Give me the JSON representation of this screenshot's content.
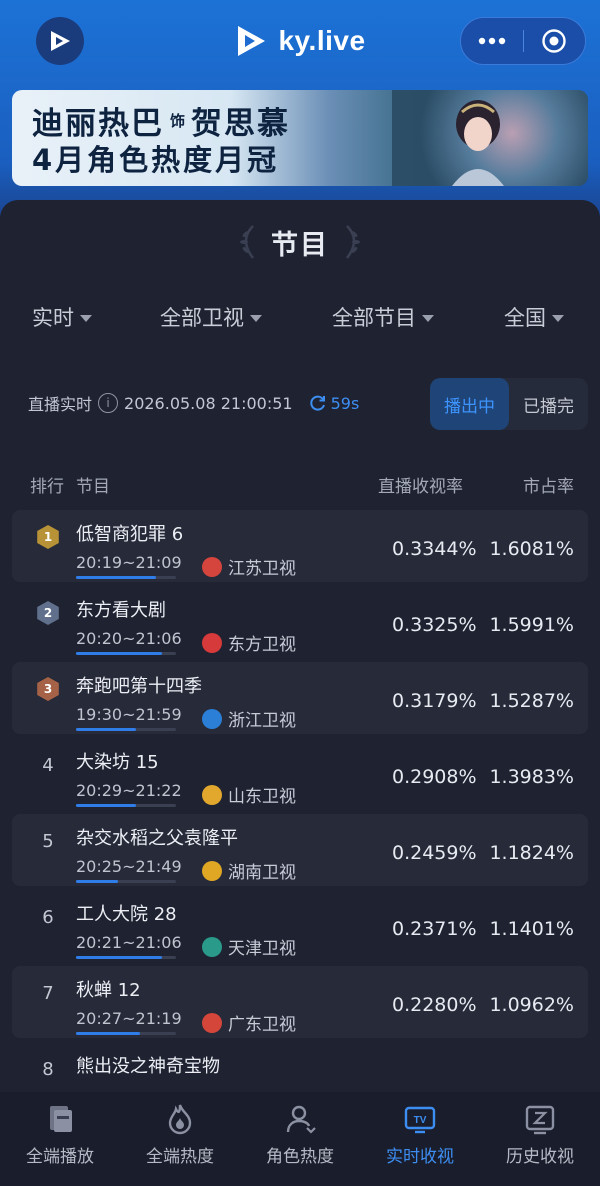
{
  "header": {
    "brand": "ky.live",
    "banner_line1_a": "迪丽热巴",
    "banner_line1_small": "饰",
    "banner_line1_b": "贺思慕",
    "banner_line2": "4月角色热度月冠"
  },
  "section": {
    "title": "节目"
  },
  "filters": [
    {
      "label": "实时"
    },
    {
      "label": "全部卫视"
    },
    {
      "label": "全部节目"
    },
    {
      "label": "全国"
    }
  ],
  "status": {
    "label": "直播实时",
    "datetime": "2026.05.08 21:00:51",
    "countdown": "59s"
  },
  "toggle": {
    "on_air": "播出中",
    "ended": "已播完"
  },
  "table": {
    "headers": {
      "rank": "排行",
      "program": "节目",
      "rating": "直播收视率",
      "share": "市占率"
    },
    "rows": [
      {
        "rank": "1",
        "name": "低智商犯罪 6",
        "time": "20:19~21:09",
        "channel": "江苏卫视",
        "rating": "0.3344%",
        "share": "1.6081%",
        "progress": 0.8,
        "medal": "#b79237",
        "logo": "#d5453d"
      },
      {
        "rank": "2",
        "name": "东方看大剧",
        "time": "20:20~21:06",
        "channel": "东方卫视",
        "rating": "0.3325%",
        "share": "1.5991%",
        "progress": 0.86,
        "medal": "#5f6f8c",
        "logo": "#d63a3a"
      },
      {
        "rank": "3",
        "name": "奔跑吧第十四季",
        "time": "19:30~21:59",
        "channel": "浙江卫视",
        "rating": "0.3179%",
        "share": "1.5287%",
        "progress": 0.6,
        "medal": "#a56246",
        "logo": "#2b7fd6"
      },
      {
        "rank": "4",
        "name": "大染坊 15",
        "time": "20:29~21:22",
        "channel": "山东卫视",
        "rating": "0.2908%",
        "share": "1.3983%",
        "progress": 0.6,
        "medal": "",
        "logo": "#e1a82d"
      },
      {
        "rank": "5",
        "name": "杂交水稻之父袁隆平",
        "time": "20:25~21:49",
        "channel": "湖南卫视",
        "rating": "0.2459%",
        "share": "1.1824%",
        "progress": 0.42,
        "medal": "",
        "logo": "#e0a725"
      },
      {
        "rank": "6",
        "name": "工人大院 28",
        "time": "20:21~21:06",
        "channel": "天津卫视",
        "rating": "0.2371%",
        "share": "1.1401%",
        "progress": 0.86,
        "medal": "",
        "logo": "#2a9a8a"
      },
      {
        "rank": "7",
        "name": "秋蝉 12",
        "time": "20:27~21:19",
        "channel": "广东卫视",
        "rating": "0.2280%",
        "share": "1.0962%",
        "progress": 0.64,
        "medal": "",
        "logo": "#d4463a"
      },
      {
        "rank": "8",
        "name": "熊出没之神奇宝物",
        "time": "",
        "channel": "",
        "rating": "",
        "share": "",
        "progress": 0,
        "medal": "",
        "logo": ""
      }
    ]
  },
  "tabbar": [
    {
      "label": "全端播放",
      "icon": "book-icon"
    },
    {
      "label": "全端热度",
      "icon": "flame-icon"
    },
    {
      "label": "角色热度",
      "icon": "person-icon"
    },
    {
      "label": "实时收视",
      "icon": "tv-icon",
      "active": true
    },
    {
      "label": "历史收视",
      "icon": "history-tv-icon"
    }
  ],
  "colors": {
    "accent": "#3d8ef2",
    "background": "#1e2231",
    "header_blue": "#1d72d6"
  }
}
